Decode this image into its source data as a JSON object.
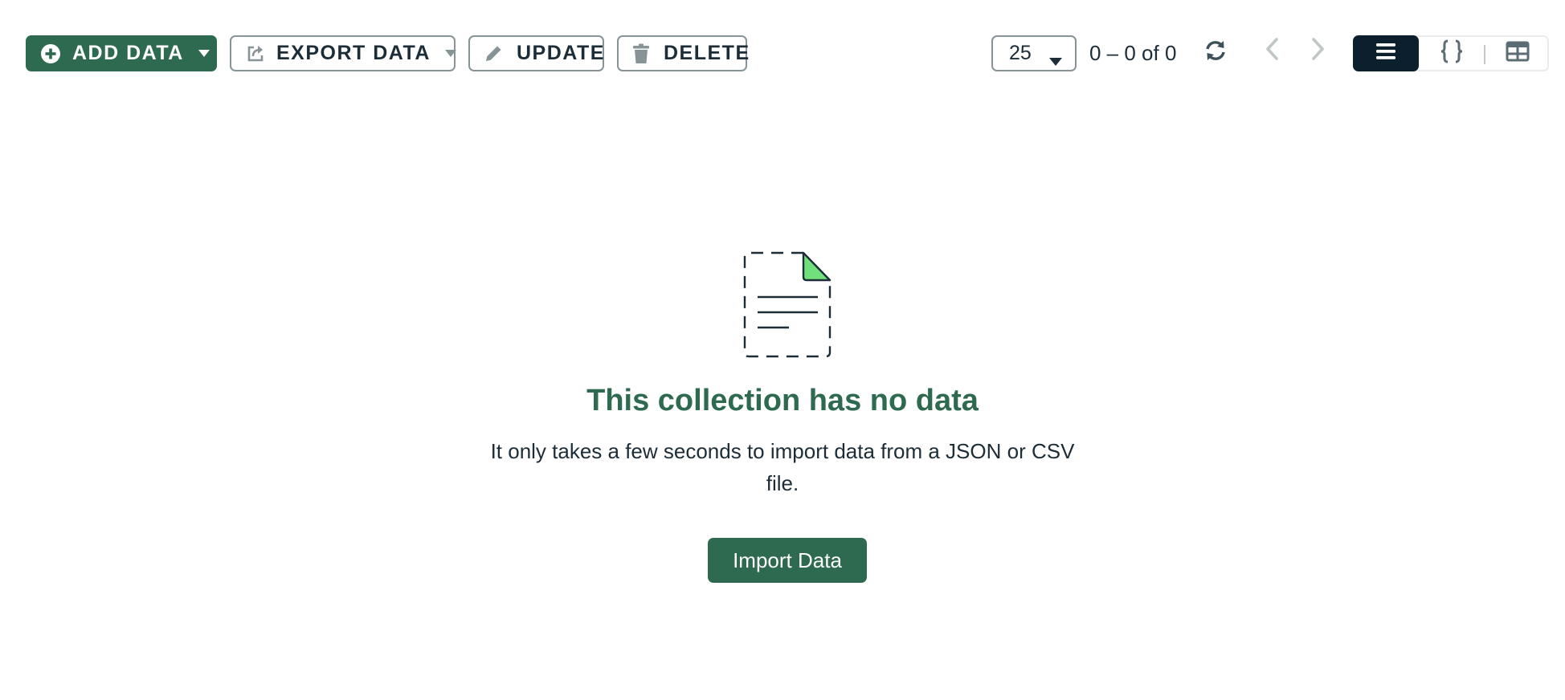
{
  "toolbar": {
    "add_data": {
      "label": "ADD DATA",
      "icon": "plus-circle-icon"
    },
    "export_data": {
      "label": "EXPORT DATA",
      "icon": "export-icon"
    },
    "update": {
      "label": "UPDATE",
      "icon": "pencil-icon"
    },
    "delete": {
      "label": "DELETE",
      "icon": "trash-icon"
    }
  },
  "pagination": {
    "page_size": "25",
    "range": "0 – 0 of 0",
    "refresh_icon": "refresh-icon",
    "prev_icon": "chevron-left-icon",
    "next_icon": "chevron-right-icon"
  },
  "view_toggle": {
    "options": [
      {
        "name": "list",
        "icon": "list-icon",
        "active": true
      },
      {
        "name": "json",
        "icon": "curly-braces-icon",
        "active": false
      },
      {
        "name": "table",
        "icon": "table-icon",
        "active": false
      }
    ]
  },
  "empty_state": {
    "illustration_icon": "empty-document-icon",
    "title": "This collection has no data",
    "description": "It only takes a few seconds to import data from a JSON or CSV file.",
    "import_label": "Import Data"
  },
  "colors": {
    "brand_green": "#2d6a4f",
    "dark_navy": "#0b1f2c",
    "border_gray": "#889397",
    "doc_corner_green": "#71e07a"
  }
}
